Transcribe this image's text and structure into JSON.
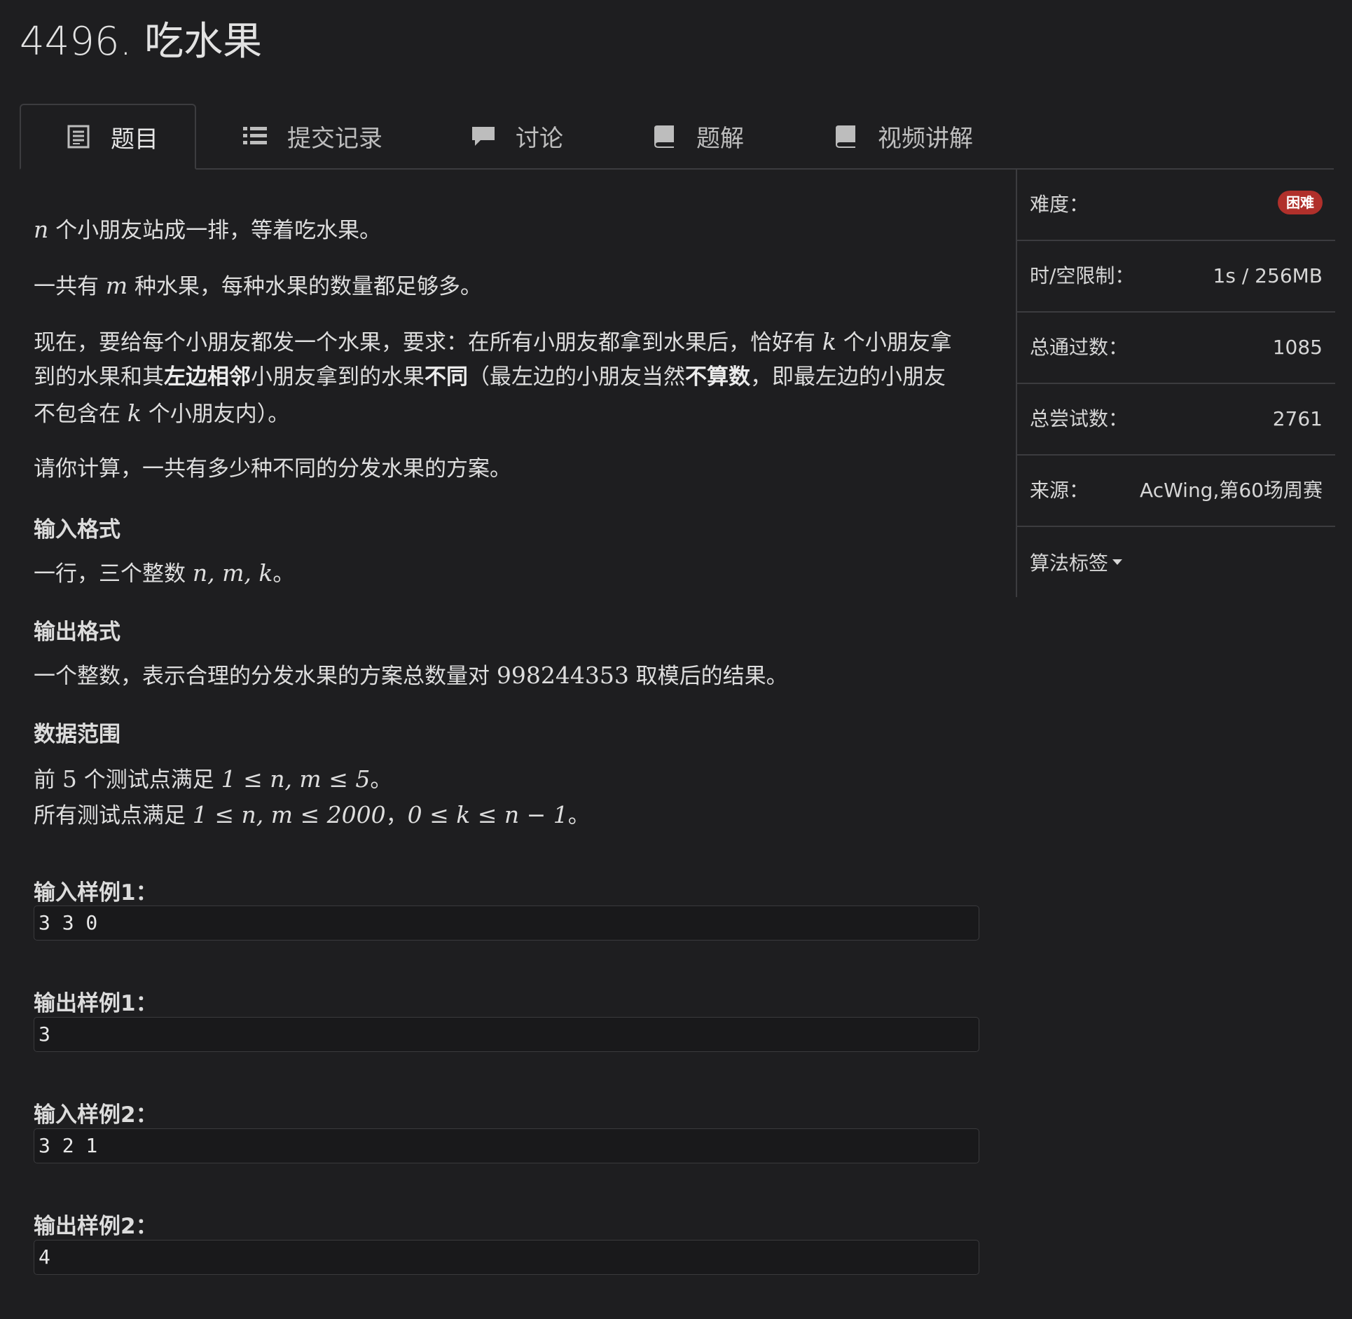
{
  "page": {
    "title": "4496. 吃水果"
  },
  "tabs": [
    {
      "label": "题目",
      "icon": "document-icon",
      "active": true
    },
    {
      "label": "提交记录",
      "icon": "list-icon",
      "active": false
    },
    {
      "label": "讨论",
      "icon": "comment-icon",
      "active": false
    },
    {
      "label": "题解",
      "icon": "book-icon",
      "active": false
    },
    {
      "label": "视频讲解",
      "icon": "book-icon",
      "active": false
    }
  ],
  "problem": {
    "p1": {
      "var": "n",
      "text": " 个小朋友站成一排，等着吃水果。"
    },
    "p2": {
      "pre": "一共有 ",
      "var": "m",
      "post": " 种水果，每种水果的数量都足够多。"
    },
    "p3": {
      "l1_pre": "现在，要给每个小朋友都发一个水果，要求：在所有小朋友都拿到水果后，恰好有 ",
      "l1_var": "k",
      "l1_post": " 个小朋友拿",
      "l2_a": "到的水果和其",
      "l2_b": "左边相邻",
      "l2_c": "小朋友拿到的水果",
      "l2_d": "不同",
      "l2_e": "（最左边的小朋友当然",
      "l2_f": "不算数",
      "l2_g": "，即最左边的小朋友",
      "l3_pre": "不包含在 ",
      "l3_var": "k",
      "l3_post": " 个小朋友内）。"
    },
    "p4": "请你计算，一共有多少种不同的分发水果的方案。",
    "input_format": {
      "heading": "输入格式",
      "pre": "一行，三个整数 ",
      "math": "n, m, k",
      "post": "。"
    },
    "output_format": {
      "heading": "输出格式",
      "pre": "一个整数，表示合理的分发水果的方案总数量对 ",
      "math": "998244353",
      "post": " 取模后的结果。"
    },
    "data_range": {
      "heading": "数据范围",
      "l1_pre": "前 ",
      "l1_num": "5",
      "l1_mid": " 个测试点满足 ",
      "l1_math": "1 ≤ n, m ≤ 5",
      "l1_post": "。",
      "l2_pre": "所有测试点满足 ",
      "l2_math_a": "1 ≤ n, m ≤ 2000",
      "l2_sep": "，",
      "l2_math_b": "0 ≤ k ≤ n − 1",
      "l2_post": "。"
    },
    "samples": [
      {
        "label": "输入样例1：",
        "value": "3 3 0"
      },
      {
        "label": "输出样例1：",
        "value": "3"
      },
      {
        "label": "输入样例2：",
        "value": "3 2 1"
      },
      {
        "label": "输出样例2：",
        "value": "4"
      }
    ]
  },
  "sidebar": {
    "difficulty": {
      "label": "难度：",
      "value": "困难",
      "color": "#b0302b"
    },
    "limits": {
      "label": "时/空限制：",
      "value": "1s / 256MB"
    },
    "accepted": {
      "label": "总通过数：",
      "value": "1085"
    },
    "attempts": {
      "label": "总尝试数：",
      "value": "2761"
    },
    "source": {
      "label": "来源：",
      "value": "AcWing,第60场周赛"
    },
    "tags": {
      "label": "算法标签"
    }
  }
}
